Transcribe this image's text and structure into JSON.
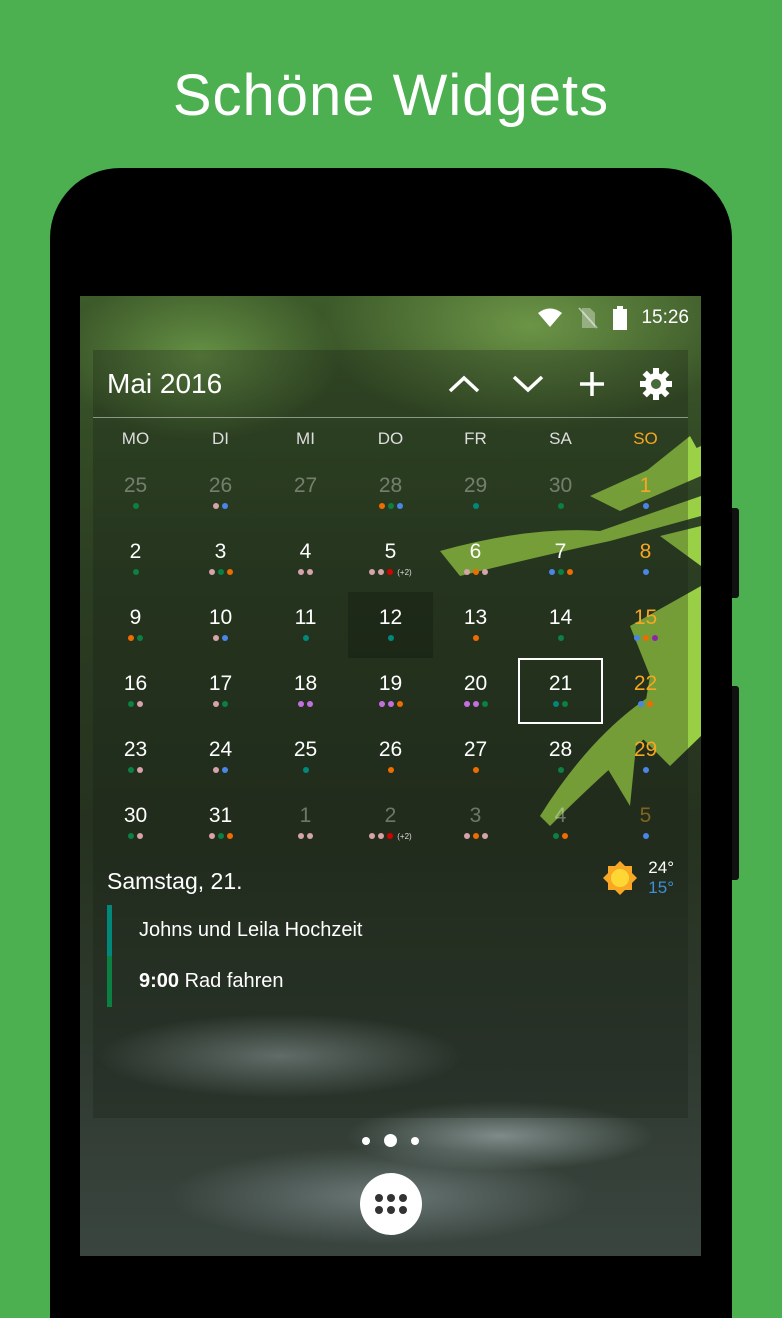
{
  "headline": "Schöne Widgets",
  "status_bar": {
    "time": "15:26",
    "icons": [
      "wifi-icon",
      "no-sim-icon",
      "battery-icon"
    ]
  },
  "widget": {
    "month_title": "Mai 2016",
    "actions": [
      "chevron-up-icon",
      "chevron-down-icon",
      "add-icon",
      "settings-icon"
    ],
    "weekdays": [
      "MO",
      "DI",
      "MI",
      "DO",
      "FR",
      "SA",
      "SO"
    ],
    "colors": {
      "p": "#d7a3ab",
      "g": "#0b8043",
      "b": "#4a86e8",
      "o": "#ef6c00",
      "t": "#00897b",
      "r": "#d50000",
      "v": "#c46fe0",
      "u": "#8e24aa",
      "sunday": "#f5a623",
      "accent": "#4caf50"
    },
    "days": [
      {
        "n": "25",
        "m": true,
        "d": "g"
      },
      {
        "n": "26",
        "m": true,
        "d": "pb"
      },
      {
        "n": "27",
        "m": true,
        "d": ""
      },
      {
        "n": "28",
        "m": true,
        "d": "ogb"
      },
      {
        "n": "29",
        "m": true,
        "d": "t"
      },
      {
        "n": "30",
        "m": true,
        "d": "g"
      },
      {
        "n": "1",
        "d": "b"
      },
      {
        "n": "2",
        "d": "g"
      },
      {
        "n": "3",
        "d": "pgo"
      },
      {
        "n": "4",
        "d": "pp"
      },
      {
        "n": "5",
        "d": "ppr",
        "x": "(+2)"
      },
      {
        "n": "6",
        "d": "pop"
      },
      {
        "n": "7",
        "d": "bgo"
      },
      {
        "n": "8",
        "d": "b"
      },
      {
        "n": "9",
        "d": "og"
      },
      {
        "n": "10",
        "d": "pb"
      },
      {
        "n": "11",
        "d": "t"
      },
      {
        "n": "12",
        "d": "t",
        "today": true
      },
      {
        "n": "13",
        "d": "o"
      },
      {
        "n": "14",
        "d": "g"
      },
      {
        "n": "15",
        "d": "bou"
      },
      {
        "n": "16",
        "d": "gp"
      },
      {
        "n": "17",
        "d": "pg"
      },
      {
        "n": "18",
        "d": "vv"
      },
      {
        "n": "19",
        "d": "vvo"
      },
      {
        "n": "20",
        "d": "vvg"
      },
      {
        "n": "21",
        "d": "tg",
        "sel": true
      },
      {
        "n": "22",
        "d": "bo"
      },
      {
        "n": "23",
        "d": "gp"
      },
      {
        "n": "24",
        "d": "pb"
      },
      {
        "n": "25",
        "d": "t"
      },
      {
        "n": "26",
        "d": "o"
      },
      {
        "n": "27",
        "d": "o"
      },
      {
        "n": "28",
        "d": "g"
      },
      {
        "n": "29",
        "d": "b"
      },
      {
        "n": "30",
        "d": "gp"
      },
      {
        "n": "31",
        "d": "pgo"
      },
      {
        "n": "1",
        "m": true,
        "d": "pp"
      },
      {
        "n": "2",
        "m": true,
        "d": "ppr",
        "x": "(+2)"
      },
      {
        "n": "3",
        "m": true,
        "d": "pop"
      },
      {
        "n": "4",
        "m": true,
        "d": "go"
      },
      {
        "n": "5",
        "m": true,
        "d": "b"
      }
    ],
    "agenda": {
      "date": "Samstag, 21.",
      "weather": {
        "icon": "sun-icon",
        "high": "24°",
        "low": "15°"
      },
      "events": [
        {
          "time": "",
          "title": "Johns und Leila Hochzeit",
          "color": "#00897b"
        },
        {
          "time": "9:00",
          "title": "Rad fahren",
          "color": "#0b8043"
        }
      ]
    }
  },
  "home": {
    "pages": 3,
    "active_page": 2,
    "drawer_icon": "app-drawer-icon"
  }
}
